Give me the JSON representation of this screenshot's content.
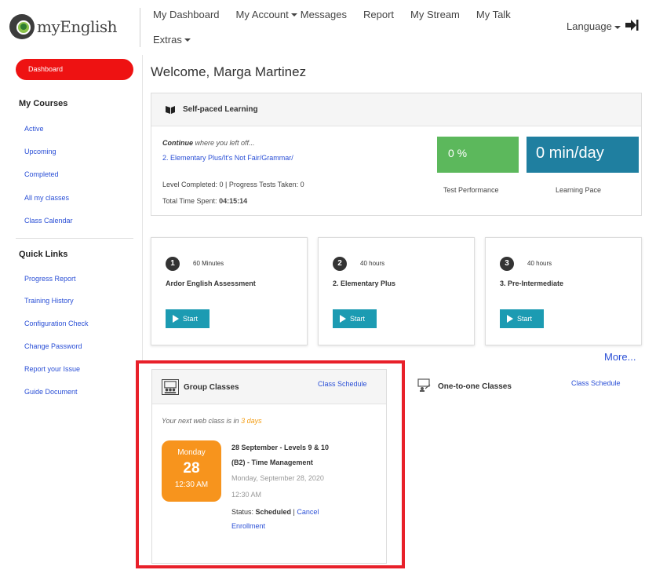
{
  "header": {
    "logo_text": "myEnglish",
    "nav_items": [
      "My Dashboard",
      "My Account",
      "Messages",
      "Report",
      "My Stream",
      "My Talk"
    ],
    "nav_extras": "Extras",
    "language": "Language"
  },
  "sidebar": {
    "dashboard": "Dashboard",
    "my_courses_heading": "My Courses",
    "course_links": [
      "Active",
      "Upcoming",
      "Completed",
      "All my classes",
      "Class Calendar"
    ],
    "quick_links_heading": "Quick Links",
    "quick_links": [
      "Progress Report",
      "Training History",
      "Configuration Check",
      "Change Password",
      "Report your Issue",
      "Guide Document"
    ]
  },
  "main": {
    "welcome": "Welcome, Marga Martinez",
    "self_paced": {
      "title": "Self-paced Learning",
      "continue_bold": "Continue",
      "continue_rest": " where you left off...",
      "course_link": "2. Elementary Plus/It's Not Fair/Grammar/",
      "level_completed": "Level Completed: 0 | Progress Tests Taken: 0",
      "time_spent_label": "Total Time Spent:",
      "time_spent_value": "04:15:14",
      "test_performance_value": "0 %",
      "test_performance_label": "Test Performance",
      "learning_pace_value": "0 min/day",
      "learning_pace_label": "Learning Pace"
    },
    "courses": [
      {
        "num": "1",
        "duration": "60 Minutes",
        "title": "Ardor English Assessment",
        "start": "Start"
      },
      {
        "num": "2",
        "duration": "40 hours",
        "title": "2. Elementary Plus",
        "start": "Start"
      },
      {
        "num": "3",
        "duration": "40 hours",
        "title": "3. Pre-Intermediate",
        "start": "Start"
      }
    ],
    "more": "More...",
    "group_classes": {
      "title": "Group Classes",
      "schedule_link": "Class Schedule",
      "next_prefix": "Your next web class is in ",
      "next_days": "3 days",
      "day": "Monday",
      "date": "28",
      "time": "12:30 AM",
      "event_line1": "28 September - Levels 9 & 10",
      "event_line2": "(B2) - Time Management",
      "event_date": "Monday, September 28, 2020",
      "event_time": "12:30 AM",
      "status_label": "Status:",
      "status_value": "Scheduled",
      "cancel_part1": "Cancel",
      "cancel_part2": "Enrollment"
    },
    "one_to_one": {
      "title": "One-to-one Classes",
      "schedule_link": "Class Schedule"
    }
  },
  "colors": {
    "dashboard_red": "#ee1212",
    "highlight_red": "#e8202a",
    "tile_green": "#5cb85c",
    "tile_teal": "#1f7fa0",
    "start_button": "#1c9bb2",
    "date_tile_orange": "#f7941d",
    "link_blue": "#2a4fd6"
  }
}
